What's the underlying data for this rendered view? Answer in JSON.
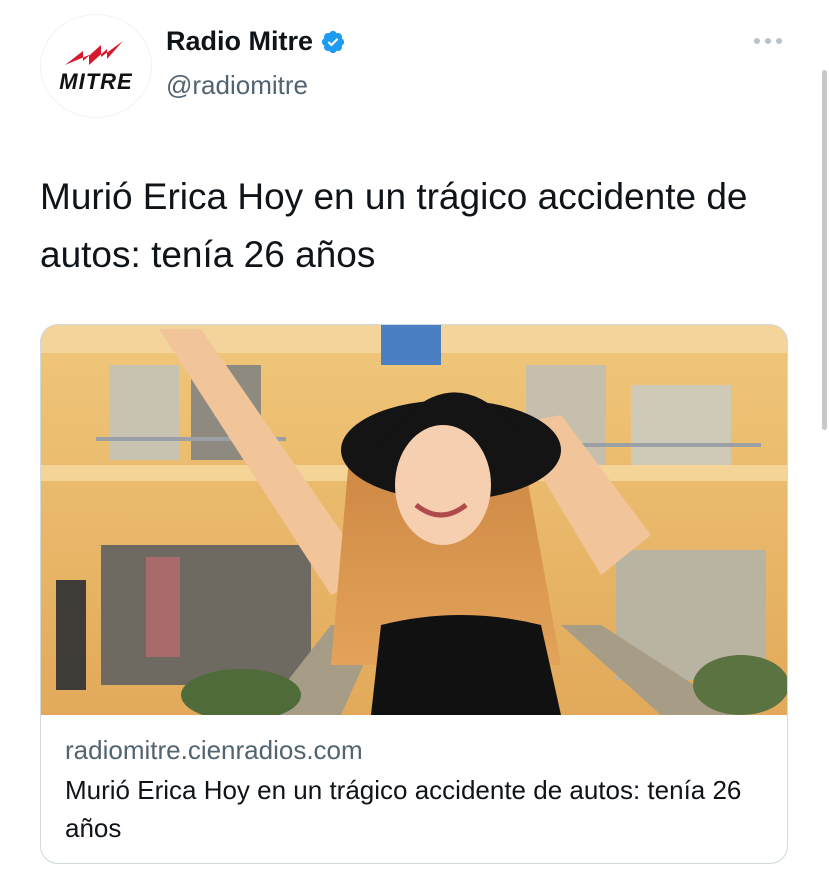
{
  "author": {
    "display_name": "Radio Mitre",
    "handle": "@radiomitre",
    "verified": true,
    "avatar_logo_text": "MITRE",
    "avatar_icon": "radio-waves-logo-icon"
  },
  "tweet": {
    "text": "Murió Erica Hoy en un trágico accidente de autos: tenía 26 años",
    "more_icon": "more-horizontal-icon"
  },
  "card": {
    "domain": "radiomitre.cienradios.com",
    "title": "Murió Erica Hoy en un trágico accidente de autos: tenía 26 años",
    "image_alt": "woman-in-hat-photo"
  },
  "colors": {
    "verified_badge": "#1d9bf0",
    "logo_red": "#d6182c",
    "secondary_text": "#536471"
  }
}
